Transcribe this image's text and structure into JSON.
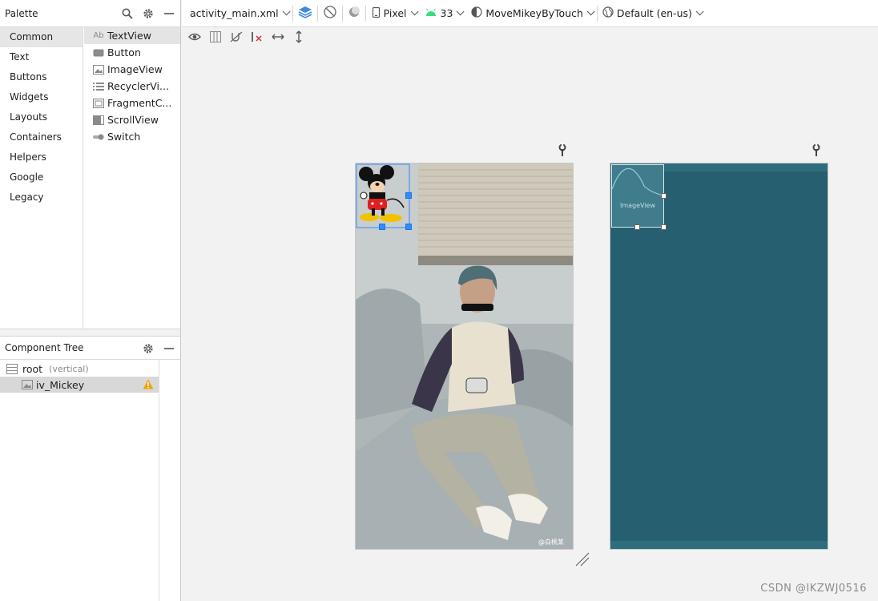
{
  "palette": {
    "title": "Palette",
    "categories": [
      "Common",
      "Text",
      "Buttons",
      "Widgets",
      "Layouts",
      "Containers",
      "Helpers",
      "Google",
      "Legacy"
    ],
    "selected_category": "Common",
    "widgets": [
      {
        "label": "TextView",
        "icon": "textview-icon",
        "icon_text": "Ab"
      },
      {
        "label": "Button",
        "icon": "button-icon"
      },
      {
        "label": "ImageView",
        "icon": "imageview-icon"
      },
      {
        "label": "RecyclerVi...",
        "icon": "recyclerview-icon"
      },
      {
        "label": "FragmentC...",
        "icon": "fragmentcontainer-icon"
      },
      {
        "label": "ScrollView",
        "icon": "scrollview-icon"
      },
      {
        "label": "Switch",
        "icon": "switch-icon"
      }
    ]
  },
  "component_tree": {
    "title": "Component Tree",
    "root": {
      "label": "root",
      "sub": "(vertical)"
    },
    "child": {
      "label": "iv_Mickey"
    }
  },
  "toolbar": {
    "file": "activity_main.xml",
    "device": "Pixel",
    "api": "33",
    "theme": "MoveMikeyByTouch",
    "locale": "Default (en-us)"
  },
  "blueprint": {
    "imageview_label": "ImageView"
  },
  "design": {
    "photo_caption": "@白桃某"
  },
  "watermark": "CSDN @IKZWJ0516",
  "colors": {
    "blueprint_bg": "#255f70",
    "selection_blue": "#2f8cff",
    "android_green": "#3ddc84",
    "warning_yellow": "#f0a30a"
  }
}
